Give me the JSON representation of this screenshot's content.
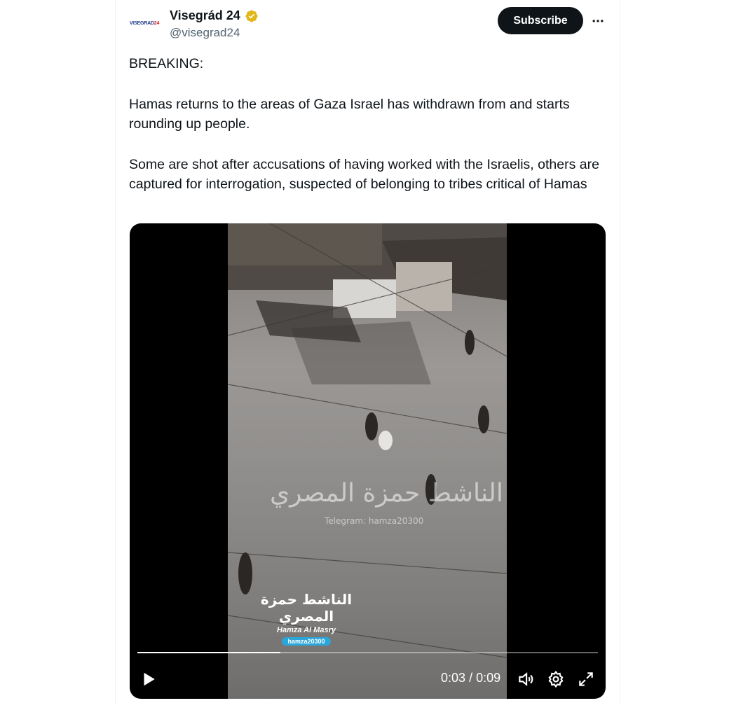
{
  "author": {
    "display_name": "Visegrád 24",
    "handle": "@visegrad24",
    "avatar_text_a": "VISEGRAD",
    "avatar_text_b": "24",
    "verified_icon": "gold-verified-badge-icon",
    "verified_color": "#e2b719"
  },
  "actions": {
    "subscribe_label": "Subscribe",
    "more_icon": "more-horizontal-icon"
  },
  "tweet": {
    "line1": "BREAKING:",
    "para2": "Hamas returns to the areas of Gaza Israel has withdrawn from and starts rounding up people.",
    "para3": "Some are shot after accusations of having worked with the Israelis, others are captured for interrogation, suspected of belonging to tribes critical of Hamas"
  },
  "video": {
    "watermark_center_arabic": "الناشط حمزة المصري",
    "watermark_telegram": "Telegram: hamza20300",
    "logo_arabic": "الناشط حمزة المصري",
    "logo_name": "Hamza Al Masry",
    "logo_handle": "hamza20300",
    "current_time": "0:03",
    "time_separator": "/",
    "duration": "0:09",
    "progress_fraction": 0.31,
    "controls": [
      "play-icon",
      "volume-icon",
      "settings-icon",
      "fullscreen-icon"
    ]
  },
  "colors": {
    "text_primary": "#0f1419",
    "text_secondary": "#536471",
    "button_dark": "#0f1419"
  }
}
